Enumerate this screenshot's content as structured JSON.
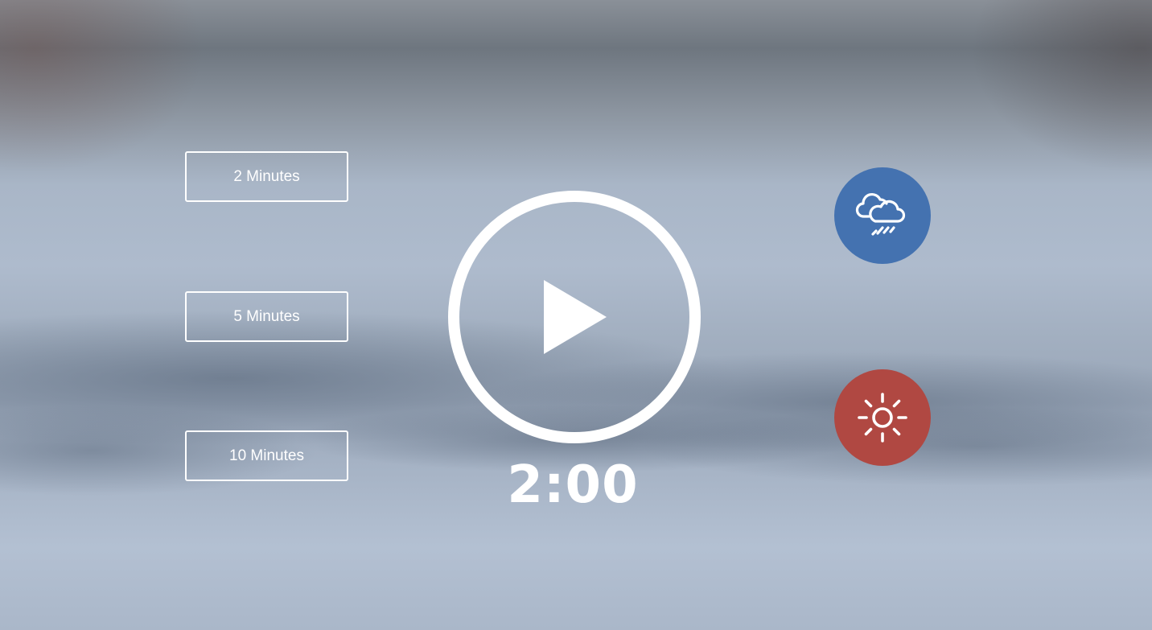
{
  "duration_options": [
    {
      "label": "2 Minutes"
    },
    {
      "label": "5 Minutes"
    },
    {
      "label": "10 Minutes"
    }
  ],
  "player": {
    "play_icon": "play-circle-icon",
    "timer_display": "2:00"
  },
  "sound_modes": [
    {
      "icon": "rain-cloud-icon",
      "color": "#4472b0"
    },
    {
      "icon": "sun-icon",
      "color": "#b04842"
    }
  ]
}
